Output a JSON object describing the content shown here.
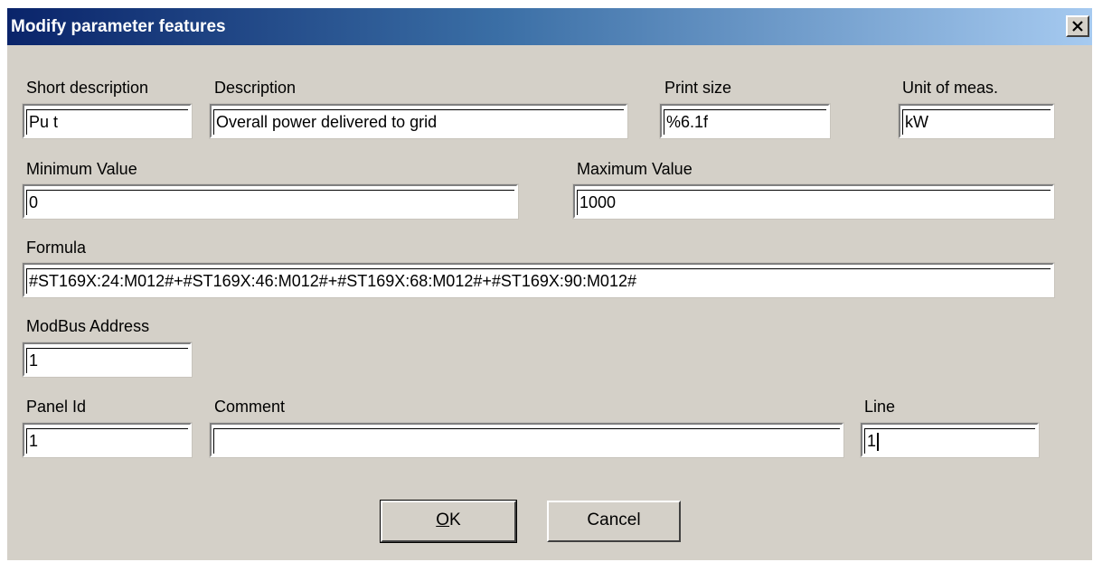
{
  "window": {
    "title": "Modify parameter features",
    "close_icon": "close-x-icon"
  },
  "fields": {
    "short_description": {
      "label": "Short description",
      "value": "Pu t"
    },
    "description": {
      "label": "Description",
      "value": "Overall power delivered to grid"
    },
    "print_size": {
      "label": "Print size",
      "value": "%6.1f"
    },
    "unit": {
      "label": "Unit of meas.",
      "value": "kW"
    },
    "min_value": {
      "label": "Minimum Value",
      "value": "0"
    },
    "max_value": {
      "label": "Maximum Value",
      "value": "1000"
    },
    "formula": {
      "label": "Formula",
      "value": "#ST169X:24:M012#+#ST169X:46:M012#+#ST169X:68:M012#+#ST169X:90:M012#"
    },
    "modbus_address": {
      "label": "ModBus Address",
      "value": "1"
    },
    "panel_id": {
      "label": "Panel Id",
      "value": "1"
    },
    "comment": {
      "label": "Comment",
      "value": ""
    },
    "line": {
      "label": "Line",
      "value": "1"
    }
  },
  "buttons": {
    "ok_mnemonic": "O",
    "ok_rest": "K",
    "cancel": "Cancel"
  },
  "colors": {
    "dialog_bg": "#d4d0c8",
    "title_gradient_start": "#0a246a",
    "title_gradient_end": "#a6caf0"
  }
}
